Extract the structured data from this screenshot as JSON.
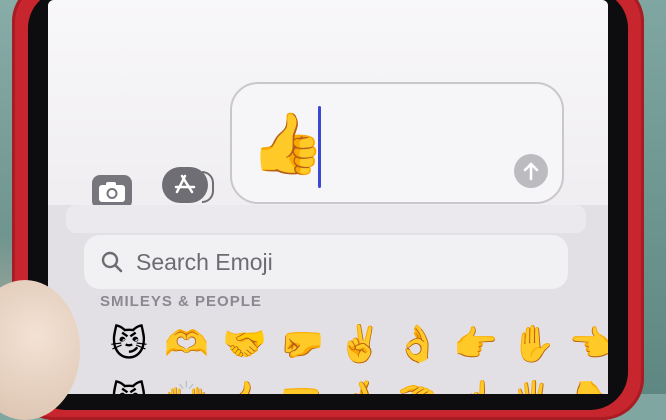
{
  "keyboard": {
    "search_placeholder": "Search Emoji",
    "category": "SMILEYS & PEOPLE",
    "emoji_row_1": [
      "😼",
      "🫶",
      "🤝",
      "🤛",
      "✌️",
      "👌",
      "👉",
      "✋",
      "👈"
    ],
    "emoji_row_2": [
      "😾",
      "🙌",
      "👍",
      "🤜",
      "🤞",
      "🤏",
      "☝️",
      "🖐️",
      "👇"
    ]
  },
  "message": {
    "content": "👍"
  },
  "colors": {
    "case": "#c8262e",
    "cursor": "#3a47d5"
  },
  "icons": {
    "camera": "camera-icon",
    "app_store": "app-store-icon",
    "send": "arrow-up-icon",
    "search": "search-icon"
  }
}
